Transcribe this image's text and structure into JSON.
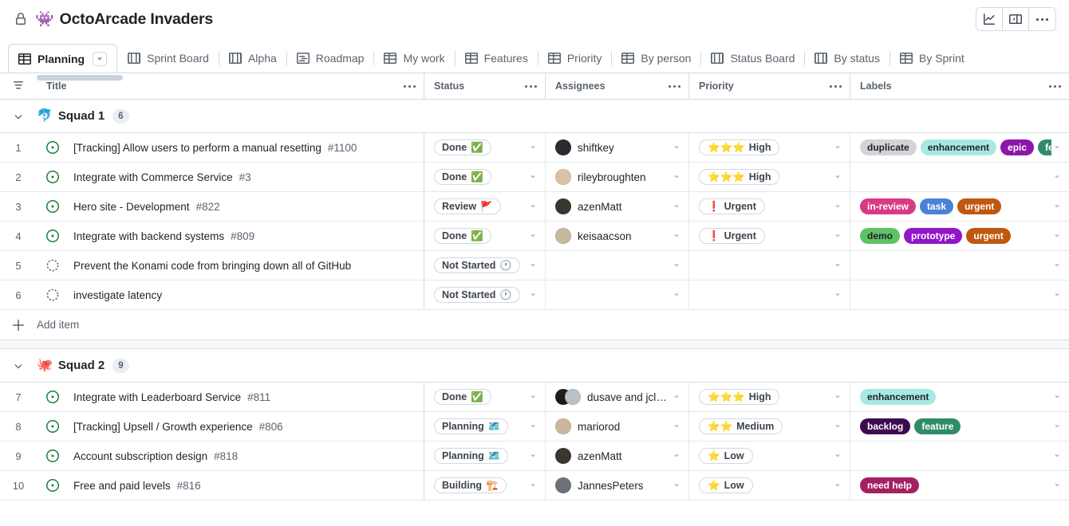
{
  "header": {
    "lock_icon": "lock-icon",
    "project_emoji": "👾",
    "title": "OctoArcade Invaders",
    "actions": [
      {
        "name": "insights-button",
        "icon": "chart-line-icon"
      },
      {
        "name": "side-panel-button",
        "icon": "side-panel-icon"
      },
      {
        "name": "more-options-button",
        "icon": "kebab-icon"
      }
    ]
  },
  "tabs": [
    {
      "label": "Planning",
      "icon": "table-icon",
      "active": true,
      "has_caret": true
    },
    {
      "label": "Sprint Board",
      "icon": "board-icon",
      "active": false,
      "has_caret": false
    },
    {
      "label": "Alpha",
      "icon": "board-icon",
      "active": false,
      "has_caret": false
    },
    {
      "label": "Roadmap",
      "icon": "roadmap-icon",
      "active": false,
      "has_caret": false
    },
    {
      "label": "My work",
      "icon": "table-icon",
      "active": false,
      "has_caret": false
    },
    {
      "label": "Features",
      "icon": "table-icon",
      "active": false,
      "has_caret": false
    },
    {
      "label": "Priority",
      "icon": "table-icon",
      "active": false,
      "has_caret": false
    },
    {
      "label": "By person",
      "icon": "table-icon",
      "active": false,
      "has_caret": false
    },
    {
      "label": "Status Board",
      "icon": "board-icon",
      "active": false,
      "has_caret": false
    },
    {
      "label": "By status",
      "icon": "board-icon",
      "active": false,
      "has_caret": false
    },
    {
      "label": "By Sprint",
      "icon": "table-icon",
      "active": false,
      "has_caret": false
    }
  ],
  "columns": [
    {
      "key": "title",
      "label": "Title",
      "menu": "…"
    },
    {
      "key": "status",
      "label": "Status",
      "menu": "…"
    },
    {
      "key": "assignees",
      "label": "Assignees",
      "menu": "…"
    },
    {
      "key": "priority",
      "label": "Priority",
      "menu": "…"
    },
    {
      "key": "labels",
      "label": "Labels",
      "menu": "…"
    }
  ],
  "filter_icon": "filter-icon",
  "add_item_label": "Add item",
  "groups": [
    {
      "name": "Squad 1",
      "emoji": "🐬",
      "count": "6",
      "collapsed": false,
      "show_add_item": true,
      "rows": [
        {
          "num": "1",
          "icon": "issue-open-icon",
          "title": "[Tracking] Allow users to perform a manual resetting",
          "issue_number": "#1100",
          "status": {
            "label": "Done",
            "emoji": "✅"
          },
          "assignees": [
            {
              "name": "shiftkey",
              "avatar": "#2b2b33"
            }
          ],
          "assignee_text": "shiftkey",
          "priority": {
            "label": "High",
            "stars": "⭐⭐⭐"
          },
          "labels": [
            {
              "text": "duplicate",
              "bg": "#d4d4d8",
              "fg": "#1f2328"
            },
            {
              "text": "enhancement",
              "bg": "#a7e8e4",
              "fg": "#1f2328"
            },
            {
              "text": "epic",
              "bg": "#8b16a8",
              "fg": "#ffffff"
            },
            {
              "text": "feature",
              "bg": "#2f8c68",
              "fg": "#ffffff"
            }
          ]
        },
        {
          "num": "2",
          "icon": "issue-open-icon",
          "title": "Integrate with Commerce Service",
          "issue_number": "#3",
          "status": {
            "label": "Done",
            "emoji": "✅"
          },
          "assignees": [
            {
              "name": "rileybroughten",
              "avatar": "#d8c3a5"
            }
          ],
          "assignee_text": "rileybroughten",
          "priority": {
            "label": "High",
            "stars": "⭐⭐⭐"
          },
          "labels": []
        },
        {
          "num": "3",
          "icon": "issue-open-icon",
          "title": "Hero site - Development",
          "issue_number": "#822",
          "status": {
            "label": "Review",
            "emoji": "🚩"
          },
          "assignees": [
            {
              "name": "azenMatt",
              "avatar": "#3a3630"
            }
          ],
          "assignee_text": "azenMatt",
          "priority": {
            "label": "Urgent",
            "stars": "❗"
          },
          "labels": [
            {
              "text": "in-review",
              "bg": "#d93a86",
              "fg": "#ffffff"
            },
            {
              "text": "task",
              "bg": "#4a83d6",
              "fg": "#ffffff"
            },
            {
              "text": "urgent",
              "bg": "#c1570f",
              "fg": "#ffffff"
            }
          ]
        },
        {
          "num": "4",
          "icon": "issue-open-icon",
          "title": "Integrate with backend systems",
          "issue_number": "#809",
          "status": {
            "label": "Done",
            "emoji": "✅"
          },
          "assignees": [
            {
              "name": "keisaacson",
              "avatar": "#c9b8a0"
            }
          ],
          "assignee_text": "keisaacson",
          "priority": {
            "label": "Urgent",
            "stars": "❗"
          },
          "labels": [
            {
              "text": "demo",
              "bg": "#5fc264",
              "fg": "#1f2328"
            },
            {
              "text": "prototype",
              "bg": "#9016c9",
              "fg": "#ffffff"
            },
            {
              "text": "urgent",
              "bg": "#c1570f",
              "fg": "#ffffff"
            }
          ]
        },
        {
          "num": "5",
          "icon": "draft-issue-icon",
          "title": "Prevent the Konami code from bringing down all of GitHub",
          "issue_number": "",
          "status": {
            "label": "Not Started",
            "emoji": "🕐"
          },
          "assignees": [],
          "assignee_text": "",
          "priority": {
            "label": "",
            "stars": ""
          },
          "labels": []
        },
        {
          "num": "6",
          "icon": "draft-issue-icon",
          "title": "investigate latency",
          "issue_number": "",
          "status": {
            "label": "Not Started",
            "emoji": "🕐"
          },
          "assignees": [],
          "assignee_text": "",
          "priority": {
            "label": "",
            "stars": ""
          },
          "labels": []
        }
      ]
    },
    {
      "name": "Squad 2",
      "emoji": "🐙",
      "count": "9",
      "collapsed": false,
      "show_add_item": false,
      "rows": [
        {
          "num": "7",
          "icon": "issue-open-icon",
          "title": "Integrate with Leaderboard Service",
          "issue_number": "#811",
          "status": {
            "label": "Done",
            "emoji": "✅"
          },
          "assignees": [
            {
              "name": "dusave",
              "avatar": "#201c1a"
            },
            {
              "name": "jclem",
              "avatar": "#b9c2c9"
            }
          ],
          "assignee_text": "dusave and jclem",
          "priority": {
            "label": "High",
            "stars": "⭐⭐⭐"
          },
          "labels": [
            {
              "text": "enhancement",
              "bg": "#a7e8e4",
              "fg": "#1f2328"
            }
          ]
        },
        {
          "num": "8",
          "icon": "issue-open-icon",
          "title": "[Tracking] Upsell / Growth experience",
          "issue_number": "#806",
          "status": {
            "label": "Planning",
            "emoji": "🗺️"
          },
          "assignees": [
            {
              "name": "mariorod",
              "avatar": "#cbb89c"
            }
          ],
          "assignee_text": "mariorod",
          "priority": {
            "label": "Medium",
            "stars": "⭐⭐"
          },
          "labels": [
            {
              "text": "backlog",
              "bg": "#3d0b4f",
              "fg": "#ffffff"
            },
            {
              "text": "feature",
              "bg": "#2f8c68",
              "fg": "#ffffff"
            }
          ]
        },
        {
          "num": "9",
          "icon": "issue-open-icon",
          "title": "Account subscription design",
          "issue_number": "#818",
          "status": {
            "label": "Planning",
            "emoji": "🗺️"
          },
          "assignees": [
            {
              "name": "azenMatt",
              "avatar": "#3a3630"
            }
          ],
          "assignee_text": "azenMatt",
          "priority": {
            "label": "Low",
            "stars": "⭐"
          },
          "labels": []
        },
        {
          "num": "10",
          "icon": "issue-open-icon",
          "title": "Free and paid levels",
          "issue_number": "#816",
          "status": {
            "label": "Building",
            "emoji": "🏗️"
          },
          "assignees": [
            {
              "name": "JannesPeters",
              "avatar": "#6d7278"
            }
          ],
          "assignee_text": "JannesPeters",
          "priority": {
            "label": "Low",
            "stars": "⭐"
          },
          "labels": [
            {
              "text": "need help",
              "bg": "#a52063",
              "fg": "#ffffff"
            }
          ]
        }
      ]
    }
  ]
}
